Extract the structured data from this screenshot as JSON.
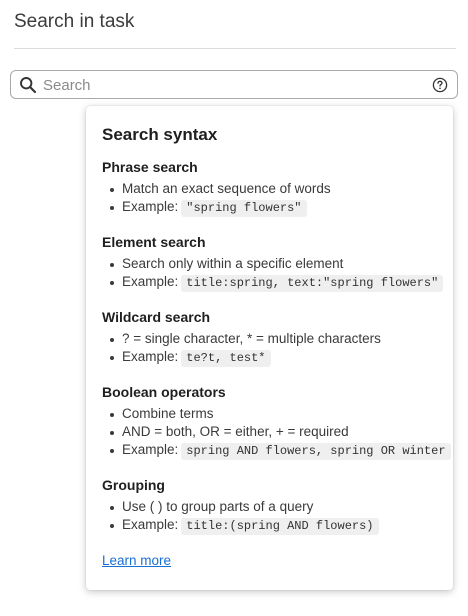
{
  "page": {
    "title": "Search in task"
  },
  "search": {
    "placeholder": "Search",
    "value": "",
    "search_icon": "search-icon",
    "help_icon": "help-circle-icon"
  },
  "popover": {
    "title": "Search syntax",
    "sections": [
      {
        "title": "Phrase search",
        "bullets": [
          {
            "text": "Match an exact sequence of words"
          },
          {
            "text": "Example:",
            "code": "\"spring flowers\""
          }
        ]
      },
      {
        "title": "Element search",
        "bullets": [
          {
            "text": "Search only within a specific element"
          },
          {
            "text": "Example:",
            "code": "title:spring, text:\"spring flowers\""
          }
        ]
      },
      {
        "title": "Wildcard search",
        "bullets": [
          {
            "text": "? = single character, * = multiple characters"
          },
          {
            "text": "Example:",
            "code": "te?t, test*"
          }
        ]
      },
      {
        "title": "Boolean operators",
        "bullets": [
          {
            "text": "Combine terms"
          },
          {
            "text": "AND = both, OR = either, + = required"
          },
          {
            "text": "Example:",
            "code": "spring AND flowers, spring OR winter"
          }
        ]
      },
      {
        "title": "Grouping",
        "bullets": [
          {
            "text": "Use ( ) to group parts of a query"
          },
          {
            "text": "Example:",
            "code": "title:(spring AND flowers)"
          }
        ]
      }
    ],
    "learn_more_label": "Learn more"
  },
  "colors": {
    "link": "#1a6fd4",
    "code_background": "#efefef",
    "border": "#a9a9a9"
  }
}
